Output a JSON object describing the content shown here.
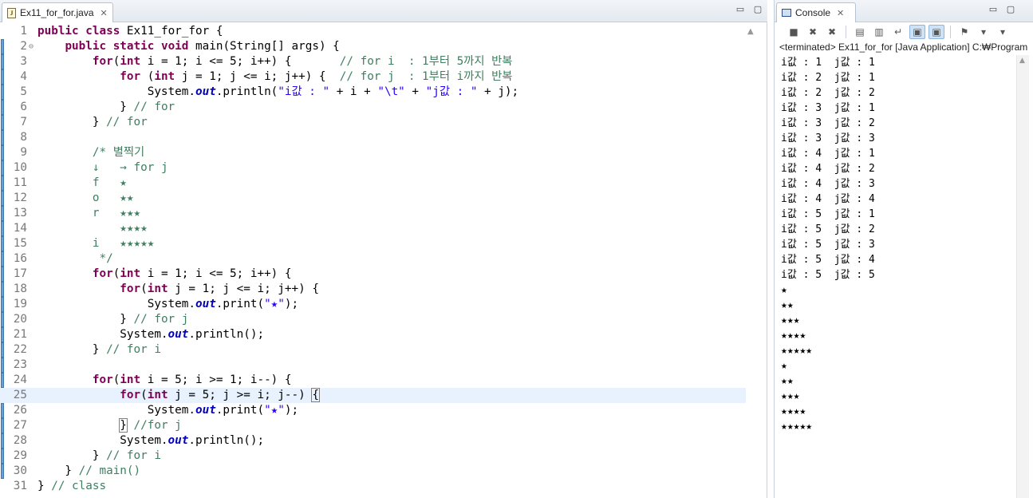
{
  "editor": {
    "tab_title": "Ex11_for_for.java",
    "file_icon_letter": "J",
    "close_glyph": "✕",
    "window_buttons": [
      "▭",
      "▢"
    ],
    "current_line": 25,
    "lines": [
      {
        "n": "1",
        "fold": "",
        "tokens": [
          {
            "t": "kw",
            "v": "public"
          },
          {
            "t": "p",
            "v": " "
          },
          {
            "t": "kw",
            "v": "class"
          },
          {
            "t": "p",
            "v": " Ex11_for_for {"
          }
        ]
      },
      {
        "n": "2",
        "fold": "⊖",
        "tokens": [
          {
            "t": "p",
            "v": "    "
          },
          {
            "t": "kw",
            "v": "public"
          },
          {
            "t": "p",
            "v": " "
          },
          {
            "t": "kw",
            "v": "static"
          },
          {
            "t": "p",
            "v": " "
          },
          {
            "t": "kw",
            "v": "void"
          },
          {
            "t": "p",
            "v": " main(String[] args) {"
          }
        ]
      },
      {
        "n": "3",
        "fold": "",
        "tokens": [
          {
            "t": "p",
            "v": "        "
          },
          {
            "t": "kw",
            "v": "for"
          },
          {
            "t": "p",
            "v": "("
          },
          {
            "t": "kw",
            "v": "int"
          },
          {
            "t": "p",
            "v": " i = 1; i <= 5; i++) {       "
          },
          {
            "t": "cm",
            "v": "// for i  : 1부터 5까지 반복"
          }
        ]
      },
      {
        "n": "4",
        "fold": "",
        "tokens": [
          {
            "t": "p",
            "v": "            "
          },
          {
            "t": "kw",
            "v": "for"
          },
          {
            "t": "p",
            "v": " ("
          },
          {
            "t": "kw",
            "v": "int"
          },
          {
            "t": "p",
            "v": " j = 1; j <= i; j++) {  "
          },
          {
            "t": "cm",
            "v": "// for j  : 1부터 i까지 반복"
          }
        ]
      },
      {
        "n": "5",
        "fold": "",
        "tokens": [
          {
            "t": "p",
            "v": "                System."
          },
          {
            "t": "fld",
            "v": "out"
          },
          {
            "t": "p",
            "v": ".println("
          },
          {
            "t": "str",
            "v": "\"i값 : \""
          },
          {
            "t": "p",
            "v": " + i + "
          },
          {
            "t": "str",
            "v": "\"\\t\""
          },
          {
            "t": "p",
            "v": " + "
          },
          {
            "t": "str",
            "v": "\"j값 : \""
          },
          {
            "t": "p",
            "v": " + j);"
          }
        ]
      },
      {
        "n": "6",
        "fold": "",
        "tokens": [
          {
            "t": "p",
            "v": "            } "
          },
          {
            "t": "cm",
            "v": "// for"
          }
        ]
      },
      {
        "n": "7",
        "fold": "",
        "tokens": [
          {
            "t": "p",
            "v": "        } "
          },
          {
            "t": "cm",
            "v": "// for"
          }
        ]
      },
      {
        "n": "8",
        "fold": "",
        "tokens": []
      },
      {
        "n": "9",
        "fold": "",
        "tokens": [
          {
            "t": "p",
            "v": "        "
          },
          {
            "t": "cm",
            "v": "/* 별찍기"
          }
        ]
      },
      {
        "n": "10",
        "fold": "",
        "tokens": [
          {
            "t": "p",
            "v": "        "
          },
          {
            "t": "cm",
            "v": "↓   → for j"
          }
        ]
      },
      {
        "n": "11",
        "fold": "",
        "tokens": [
          {
            "t": "p",
            "v": "        "
          },
          {
            "t": "cm",
            "v": "f   ★"
          }
        ]
      },
      {
        "n": "12",
        "fold": "",
        "tokens": [
          {
            "t": "p",
            "v": "        "
          },
          {
            "t": "cm",
            "v": "o   ★★"
          }
        ]
      },
      {
        "n": "13",
        "fold": "",
        "tokens": [
          {
            "t": "p",
            "v": "        "
          },
          {
            "t": "cm",
            "v": "r   ★★★"
          }
        ]
      },
      {
        "n": "14",
        "fold": "",
        "tokens": [
          {
            "t": "p",
            "v": "        "
          },
          {
            "t": "cm",
            "v": "    ★★★★"
          }
        ]
      },
      {
        "n": "15",
        "fold": "",
        "tokens": [
          {
            "t": "p",
            "v": "        "
          },
          {
            "t": "cm",
            "v": "i   ★★★★★"
          }
        ]
      },
      {
        "n": "16",
        "fold": "",
        "tokens": [
          {
            "t": "p",
            "v": "         "
          },
          {
            "t": "cm",
            "v": "*/"
          }
        ]
      },
      {
        "n": "17",
        "fold": "",
        "tokens": [
          {
            "t": "p",
            "v": "        "
          },
          {
            "t": "kw",
            "v": "for"
          },
          {
            "t": "p",
            "v": "("
          },
          {
            "t": "kw",
            "v": "int"
          },
          {
            "t": "p",
            "v": " i = 1; i <= 5; i++) {"
          }
        ]
      },
      {
        "n": "18",
        "fold": "",
        "tokens": [
          {
            "t": "p",
            "v": "            "
          },
          {
            "t": "kw",
            "v": "for"
          },
          {
            "t": "p",
            "v": "("
          },
          {
            "t": "kw",
            "v": "int"
          },
          {
            "t": "p",
            "v": " j = 1; j <= i; j++) {"
          }
        ]
      },
      {
        "n": "19",
        "fold": "",
        "tokens": [
          {
            "t": "p",
            "v": "                System."
          },
          {
            "t": "fld",
            "v": "out"
          },
          {
            "t": "p",
            "v": ".print("
          },
          {
            "t": "str",
            "v": "\"★\""
          },
          {
            "t": "p",
            "v": ");"
          }
        ]
      },
      {
        "n": "20",
        "fold": "",
        "tokens": [
          {
            "t": "p",
            "v": "            } "
          },
          {
            "t": "cm",
            "v": "// for j"
          }
        ]
      },
      {
        "n": "21",
        "fold": "",
        "tokens": [
          {
            "t": "p",
            "v": "            System."
          },
          {
            "t": "fld",
            "v": "out"
          },
          {
            "t": "p",
            "v": ".println();"
          }
        ]
      },
      {
        "n": "22",
        "fold": "",
        "tokens": [
          {
            "t": "p",
            "v": "        } "
          },
          {
            "t": "cm",
            "v": "// for i"
          }
        ]
      },
      {
        "n": "23",
        "fold": "",
        "tokens": []
      },
      {
        "n": "24",
        "fold": "",
        "tokens": [
          {
            "t": "p",
            "v": "        "
          },
          {
            "t": "kw",
            "v": "for"
          },
          {
            "t": "p",
            "v": "("
          },
          {
            "t": "kw",
            "v": "int"
          },
          {
            "t": "p",
            "v": " i = 5; i >= 1; i--) {"
          }
        ]
      },
      {
        "n": "25",
        "fold": "",
        "tokens": [
          {
            "t": "p",
            "v": "            "
          },
          {
            "t": "kw",
            "v": "for"
          },
          {
            "t": "p",
            "v": "("
          },
          {
            "t": "kw",
            "v": "int"
          },
          {
            "t": "p",
            "v": " j = 5; j >= i; j--) "
          },
          {
            "t": "brace",
            "v": "{"
          },
          {
            "t": "caret",
            "v": ""
          }
        ]
      },
      {
        "n": "26",
        "fold": "",
        "tokens": [
          {
            "t": "p",
            "v": "                System."
          },
          {
            "t": "fld",
            "v": "out"
          },
          {
            "t": "p",
            "v": ".print("
          },
          {
            "t": "str",
            "v": "\"★\""
          },
          {
            "t": "p",
            "v": ");"
          }
        ]
      },
      {
        "n": "27",
        "fold": "",
        "tokens": [
          {
            "t": "p",
            "v": "            "
          },
          {
            "t": "brace",
            "v": "}"
          },
          {
            "t": "p",
            "v": " "
          },
          {
            "t": "cm",
            "v": "//for j"
          }
        ]
      },
      {
        "n": "28",
        "fold": "",
        "tokens": [
          {
            "t": "p",
            "v": "            System."
          },
          {
            "t": "fld",
            "v": "out"
          },
          {
            "t": "p",
            "v": ".println();"
          }
        ]
      },
      {
        "n": "29",
        "fold": "",
        "tokens": [
          {
            "t": "p",
            "v": "        } "
          },
          {
            "t": "cm",
            "v": "// for i"
          }
        ]
      },
      {
        "n": "30",
        "fold": "",
        "tokens": [
          {
            "t": "p",
            "v": "    } "
          },
          {
            "t": "cm",
            "v": "// main()"
          }
        ]
      },
      {
        "n": "31",
        "fold": "",
        "tokens": [
          {
            "t": "p",
            "v": "} "
          },
          {
            "t": "cm",
            "v": "// class"
          }
        ]
      }
    ]
  },
  "console": {
    "tab_title": "Console",
    "close_glyph": "✕",
    "window_buttons": [
      "▭",
      "▢"
    ],
    "toolbar": [
      {
        "name": "terminate-icon",
        "glyph": "■",
        "on": false
      },
      {
        "name": "remove-launch-icon",
        "glyph": "✖",
        "on": false
      },
      {
        "name": "remove-all-icon",
        "glyph": "✖",
        "on": false
      },
      {
        "name": "sep",
        "glyph": "",
        "on": false
      },
      {
        "name": "clear-console-icon",
        "glyph": "▤",
        "on": false
      },
      {
        "name": "scroll-lock-icon",
        "glyph": "▥",
        "on": false
      },
      {
        "name": "word-wrap-icon",
        "glyph": "↵",
        "on": false
      },
      {
        "name": "show-on-output-icon",
        "glyph": "▣",
        "on": true
      },
      {
        "name": "show-on-error-icon",
        "glyph": "▣",
        "on": true
      },
      {
        "name": "sep",
        "glyph": "",
        "on": false
      },
      {
        "name": "pin-console-icon",
        "glyph": "⚑",
        "on": false
      },
      {
        "name": "display-console-icon",
        "glyph": "▾",
        "on": false
      },
      {
        "name": "open-console-icon",
        "glyph": "▾",
        "on": false
      }
    ],
    "status": "<terminated> Ex11_for_for [Java Application] C:₩Program",
    "output": [
      "i값 : 1  j값 : 1",
      "i값 : 2  j값 : 1",
      "i값 : 2  j값 : 2",
      "i값 : 3  j값 : 1",
      "i값 : 3  j값 : 2",
      "i값 : 3  j값 : 3",
      "i값 : 4  j값 : 1",
      "i값 : 4  j값 : 2",
      "i값 : 4  j값 : 3",
      "i값 : 4  j값 : 4",
      "i값 : 5  j값 : 1",
      "i값 : 5  j값 : 2",
      "i값 : 5  j값 : 3",
      "i값 : 5  j값 : 4",
      "i값 : 5  j값 : 5",
      "★",
      "★★",
      "★★★",
      "★★★★",
      "★★★★★",
      "★",
      "★★",
      "★★★",
      "★★★★",
      "★★★★★"
    ]
  }
}
